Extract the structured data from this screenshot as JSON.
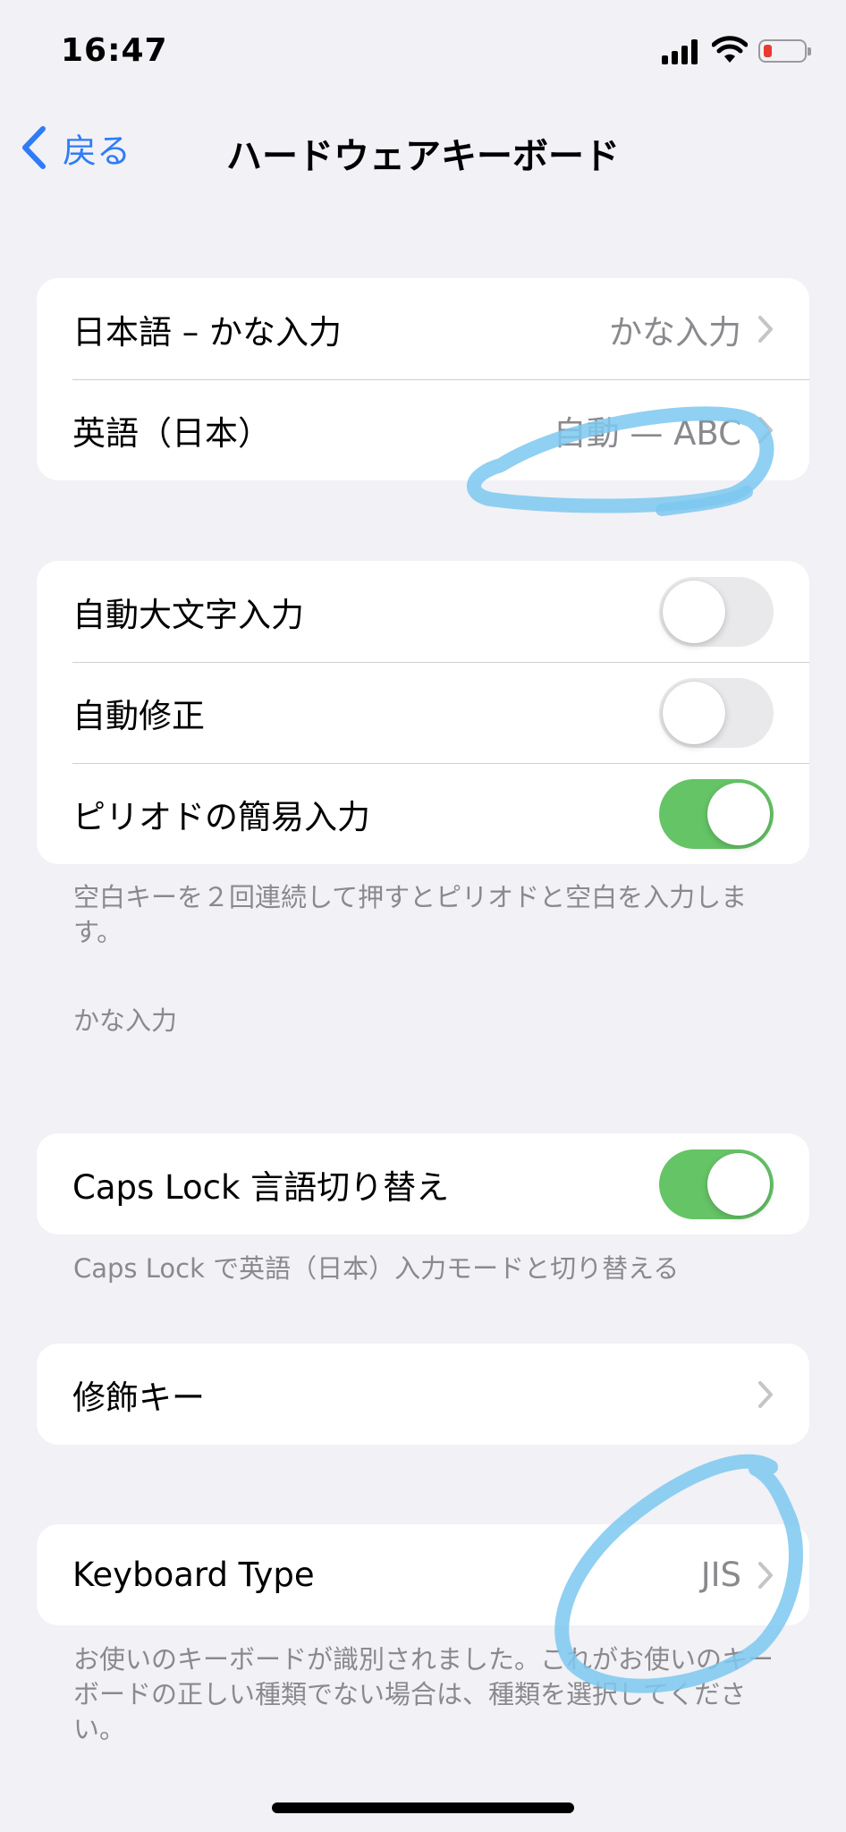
{
  "status": {
    "time": "16:47"
  },
  "nav": {
    "back_label": "戻る",
    "title": "ハードウェアキーボード"
  },
  "languages": [
    {
      "label": "日本語 – かな入力",
      "value": "かな入力"
    },
    {
      "label": "英語（日本）",
      "value": "自動 — ABC"
    }
  ],
  "settings": [
    {
      "label": "自動大文字入力",
      "on": false
    },
    {
      "label": "自動修正",
      "on": false
    },
    {
      "label": "ピリオドの簡易入力",
      "on": true
    }
  ],
  "period_footer": "空白キーを２回連続して押すとピリオドと空白を入力します。",
  "kana_header": "かな入力",
  "capslock": {
    "label": "Caps Lock 言語切り替え",
    "on": true,
    "footer": "Caps Lock で英語（日本）入力モードと切り替える"
  },
  "modifier": {
    "label": "修飾キー"
  },
  "keyboard_type": {
    "label": "Keyboard Type",
    "value": "JIS",
    "footer": "お使いのキーボードが識別されました。これがお使いのキーボードの正しい種類でない場合は、種類を選択してください。"
  },
  "colors": {
    "accent": "#2f7cf6",
    "toggle_on": "#65c466",
    "annotation": "#7cc8f0"
  }
}
